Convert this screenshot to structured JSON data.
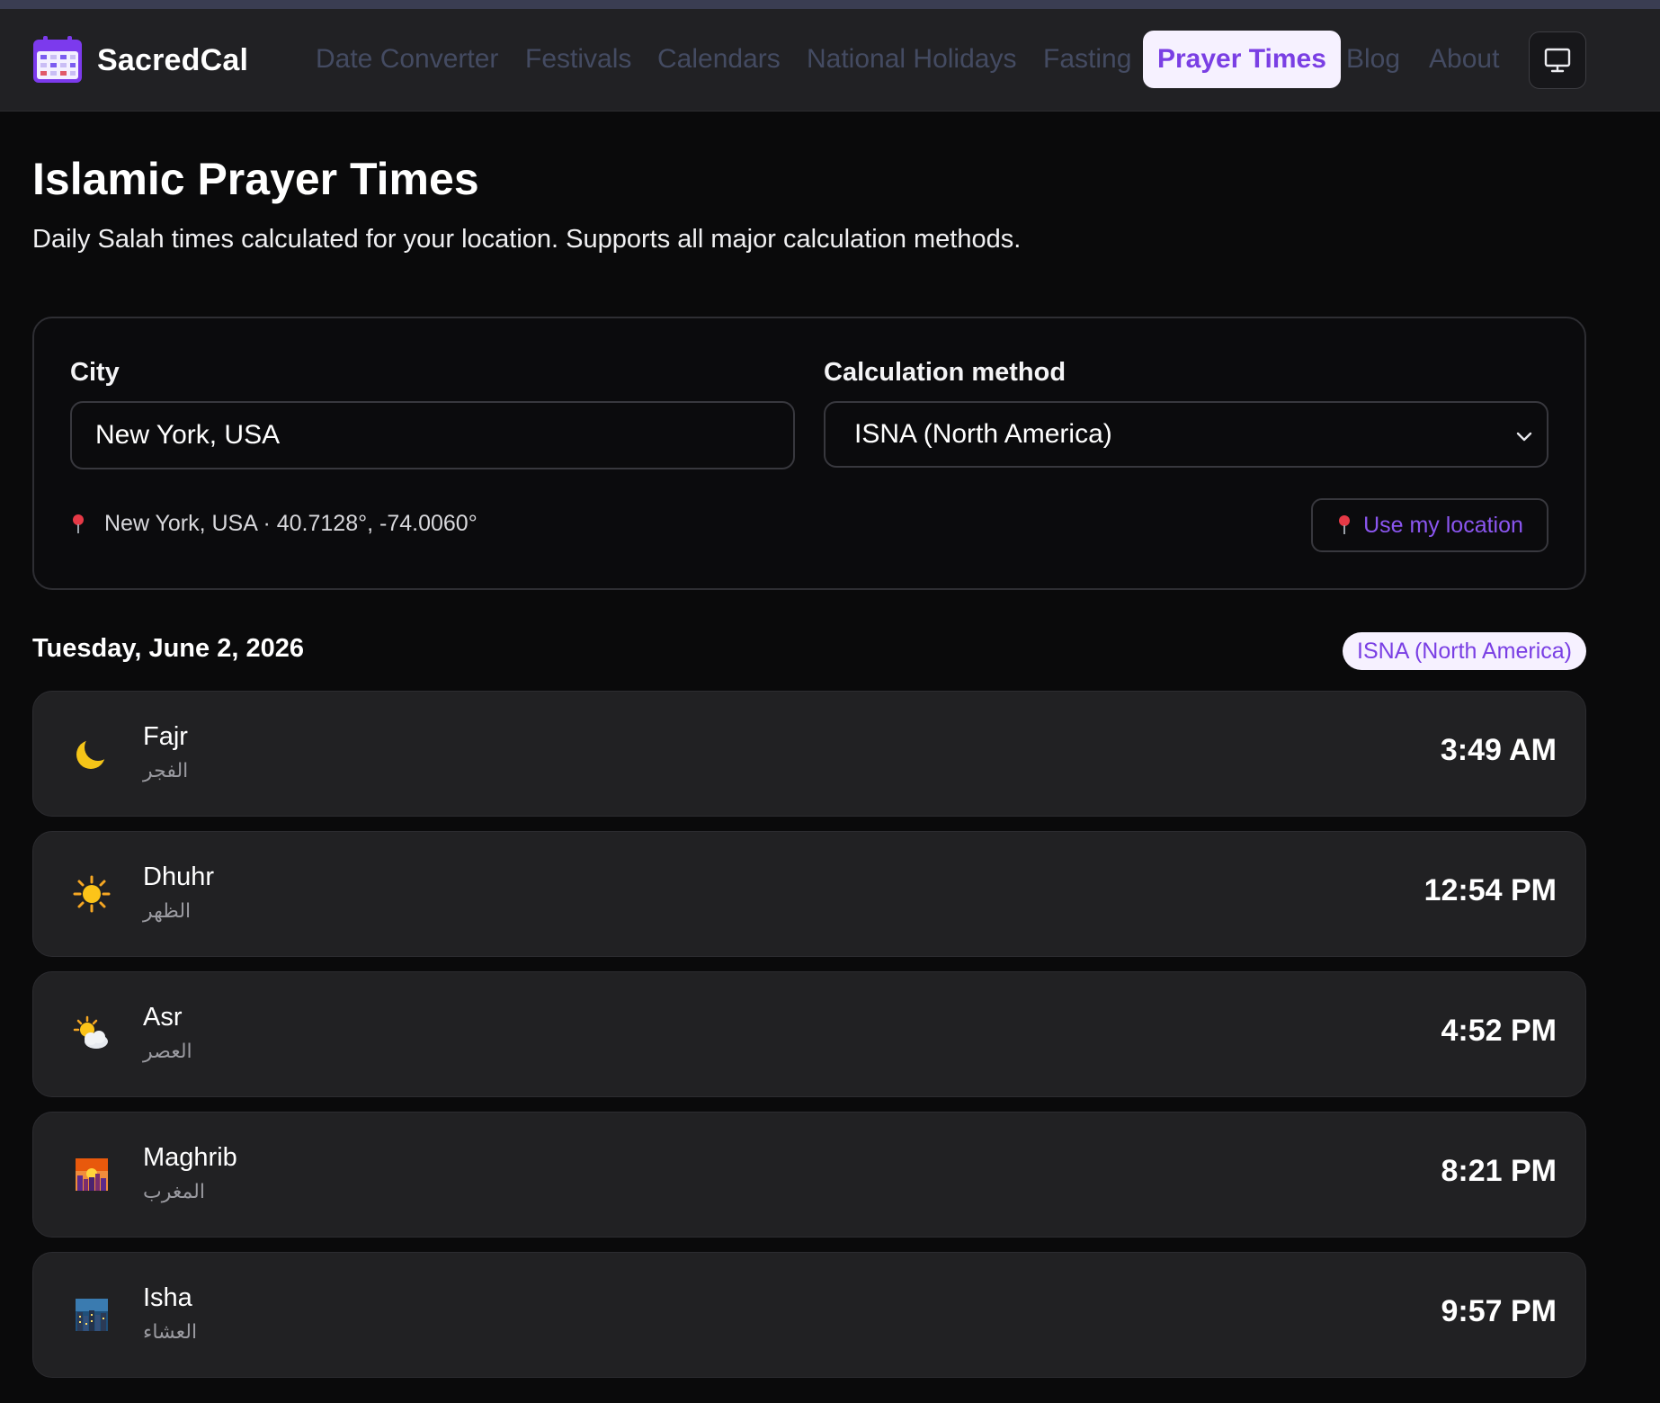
{
  "app": {
    "name": "SacredCal"
  },
  "nav": {
    "items": [
      {
        "label": "Date Converter"
      },
      {
        "label": "Festivals"
      },
      {
        "label": "Calendars"
      },
      {
        "label": "National Holidays"
      },
      {
        "label": "Fasting"
      },
      {
        "label": "Prayer Times",
        "active": true
      },
      {
        "label": "Blog"
      },
      {
        "label": "About"
      }
    ],
    "display_toggle_icon": "monitor-icon"
  },
  "page": {
    "title": "Islamic Prayer Times",
    "subtitle": "Daily Salah times calculated for your location. Supports all major calculation methods."
  },
  "form": {
    "city_label": "City",
    "city_value": "New York, USA",
    "method_label": "Calculation method",
    "method_value": "ISNA (North America)",
    "location_text": "New York, USA · 40.7128°, -74.0060°",
    "use_location_label": "Use my location"
  },
  "schedule": {
    "date": "Tuesday, June 2, 2026",
    "method_badge": "ISNA (North America)",
    "prayers": [
      {
        "name": "Fajr",
        "arabic": "الفجر",
        "time": "3:49 AM",
        "icon": "crescent-moon-icon"
      },
      {
        "name": "Dhuhr",
        "arabic": "الظهر",
        "time": "12:54 PM",
        "icon": "sun-icon"
      },
      {
        "name": "Asr",
        "arabic": "العصر",
        "time": "4:52 PM",
        "icon": "sun-behind-cloud-icon"
      },
      {
        "name": "Maghrib",
        "arabic": "المغرب",
        "time": "8:21 PM",
        "icon": "sunset-city-icon"
      },
      {
        "name": "Isha",
        "arabic": "العشاء",
        "time": "9:57 PM",
        "icon": "night-city-icon"
      }
    ]
  },
  "colors": {
    "accent": "#7a3fe4",
    "accent_bg": "#f6f1ff",
    "background": "#0a0a0b",
    "card": "#212123",
    "nav_inactive": "#444b62"
  }
}
